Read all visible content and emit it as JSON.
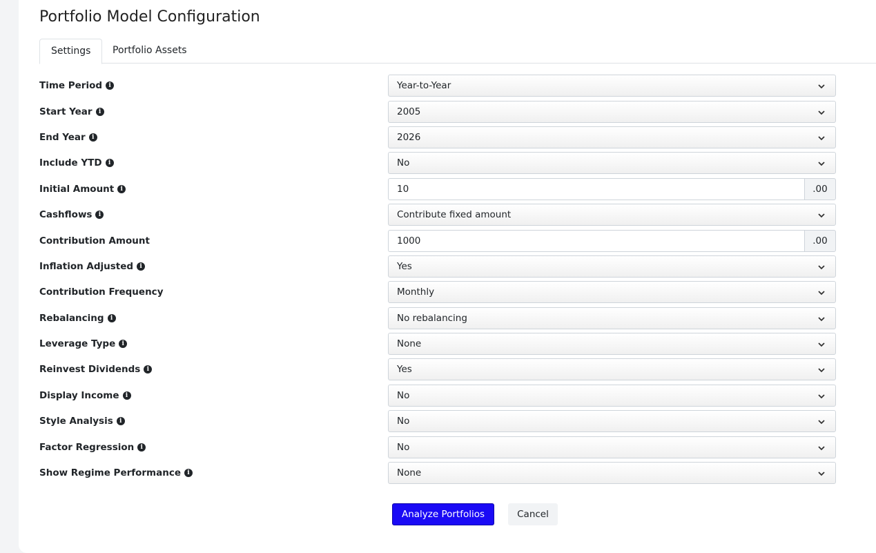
{
  "page": {
    "title": "Portfolio Model Configuration"
  },
  "tabs": [
    {
      "label": "Settings",
      "active": true
    },
    {
      "label": "Portfolio Assets",
      "active": false
    }
  ],
  "fields": {
    "time_period": {
      "label": "Time Period",
      "value": "Year-to-Year",
      "info": true
    },
    "start_year": {
      "label": "Start Year",
      "value": "2005",
      "info": true
    },
    "end_year": {
      "label": "End Year",
      "value": "2026",
      "info": true
    },
    "include_ytd": {
      "label": "Include YTD",
      "value": "No",
      "info": true
    },
    "initial_amount": {
      "label": "Initial Amount",
      "value": "10",
      "suffix": ".00",
      "info": true
    },
    "cashflows": {
      "label": "Cashflows",
      "value": "Contribute fixed amount",
      "info": true
    },
    "contribution_amount": {
      "label": "Contribution Amount",
      "value": "1000",
      "suffix": ".00",
      "info": false
    },
    "inflation_adjusted": {
      "label": "Inflation Adjusted",
      "value": "Yes",
      "info": true
    },
    "contribution_frequency": {
      "label": "Contribution Frequency",
      "value": "Monthly",
      "info": false
    },
    "rebalancing": {
      "label": "Rebalancing",
      "value": "No rebalancing",
      "info": true
    },
    "leverage_type": {
      "label": "Leverage Type",
      "value": "None",
      "info": true
    },
    "reinvest_dividends": {
      "label": "Reinvest Dividends",
      "value": "Yes",
      "info": true
    },
    "display_income": {
      "label": "Display Income",
      "value": "No",
      "info": true
    },
    "style_analysis": {
      "label": "Style Analysis",
      "value": "No",
      "info": true
    },
    "factor_regression": {
      "label": "Factor Regression",
      "value": "No",
      "info": true
    },
    "show_regime_performance": {
      "label": "Show Regime Performance",
      "value": "None",
      "info": true
    }
  },
  "info_glyph": "i",
  "buttons": {
    "analyze": "Analyze Portfolios",
    "cancel": "Cancel"
  },
  "colors": {
    "primary": "#1a0af5",
    "background": "#f3f4f6"
  },
  "icons": {
    "info": "info-circle-icon",
    "chevron": "chevron-down-icon"
  }
}
